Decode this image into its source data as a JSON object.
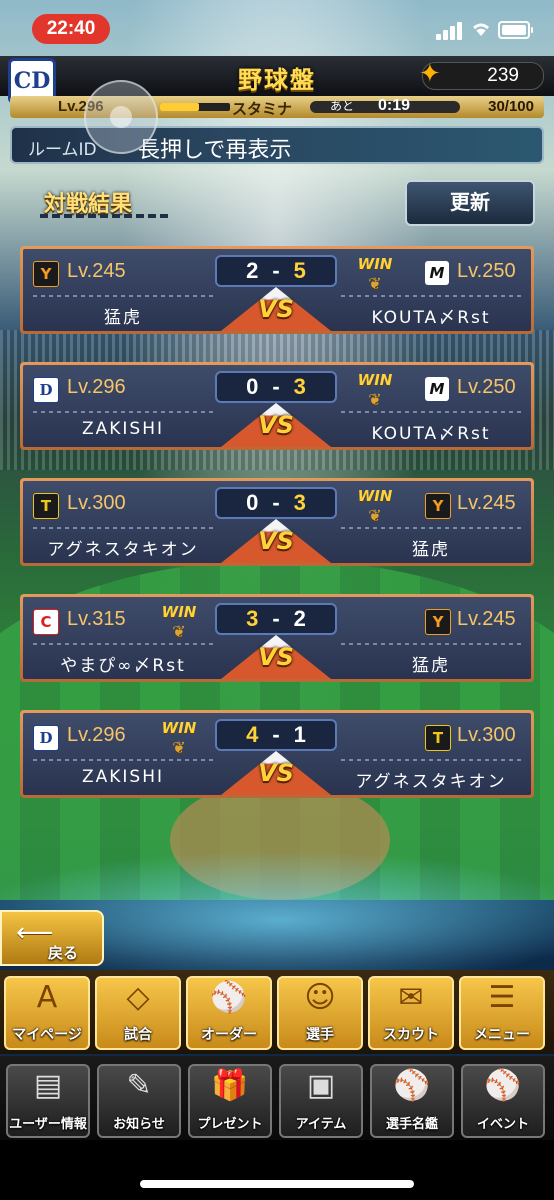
{
  "status_bar": {
    "time": "22:40"
  },
  "header": {
    "title": "野球盤",
    "team_logo": "CD",
    "coins": "239",
    "level": "Lv.296",
    "stamina_label": "スタミナ",
    "stamina_ato": "あと",
    "stamina_timer": "0:19",
    "stamina_value": "30/100"
  },
  "room": {
    "label": "ルームID",
    "message": "長押しで再表示"
  },
  "section": {
    "title": "対戦結果",
    "refresh_label": "更新"
  },
  "results": [
    {
      "left": {
        "team_icon": "giants-icon",
        "glyph": "Y",
        "level": "Lv.245",
        "name": "猛虎"
      },
      "right": {
        "team_icon": "marines-icon",
        "glyph": "M",
        "level": "Lv.250",
        "name": "KOUTA〆Rst"
      },
      "score_left": "2",
      "score_right": "5",
      "winner": "right"
    },
    {
      "left": {
        "team_icon": "dragons-icon",
        "glyph": "D",
        "level": "Lv.296",
        "name": "ZAKISHI"
      },
      "right": {
        "team_icon": "marines-icon",
        "glyph": "M",
        "level": "Lv.250",
        "name": "KOUTA〆Rst"
      },
      "score_left": "0",
      "score_right": "3",
      "winner": "right"
    },
    {
      "left": {
        "team_icon": "tigers-icon",
        "glyph": "T",
        "level": "Lv.300",
        "name": "アグネスタキオン"
      },
      "right": {
        "team_icon": "giants-icon",
        "glyph": "Y",
        "level": "Lv.245",
        "name": "猛虎"
      },
      "score_left": "0",
      "score_right": "3",
      "winner": "right"
    },
    {
      "left": {
        "team_icon": "carp-icon",
        "glyph": "C",
        "level": "Lv.315",
        "name": "やまぴ∞〆Rst"
      },
      "right": {
        "team_icon": "giants-icon",
        "glyph": "Y",
        "level": "Lv.245",
        "name": "猛虎"
      },
      "score_left": "3",
      "score_right": "2",
      "winner": "left"
    },
    {
      "left": {
        "team_icon": "dragons-icon",
        "glyph": "D",
        "level": "Lv.296",
        "name": "ZAKISHI"
      },
      "right": {
        "team_icon": "tigers-icon",
        "glyph": "T",
        "level": "Lv.300",
        "name": "アグネスタキオン"
      },
      "score_left": "4",
      "score_right": "1",
      "winner": "left"
    }
  ],
  "labels": {
    "win": "WIN",
    "vs": "VS",
    "dash": "-"
  },
  "back": {
    "label": "戻る"
  },
  "nav_primary": [
    {
      "label": "マイページ",
      "icon": "A"
    },
    {
      "label": "試合",
      "icon": "◇"
    },
    {
      "label": "オーダー",
      "icon": "⚾"
    },
    {
      "label": "選手",
      "icon": "☺"
    },
    {
      "label": "スカウト",
      "icon": "✉"
    },
    {
      "label": "メニュー",
      "icon": "☰"
    }
  ],
  "nav_secondary": [
    {
      "label": "ユーザー情報",
      "icon": "▤"
    },
    {
      "label": "お知らせ",
      "icon": "✎"
    },
    {
      "label": "プレゼント",
      "icon": "🎁"
    },
    {
      "label": "アイテム",
      "icon": "▣"
    },
    {
      "label": "選手名鑑",
      "icon": "⚾"
    },
    {
      "label": "イベント",
      "icon": "⚾"
    }
  ]
}
